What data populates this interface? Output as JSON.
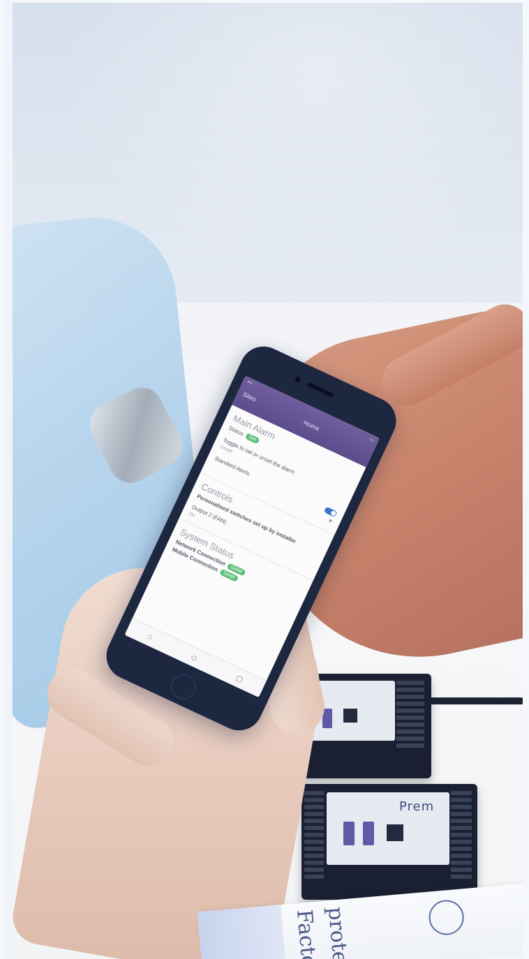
{
  "scene": {
    "description_colors": {
      "phone_header": "#5c4c8c",
      "badge_green": "#5fbf7a",
      "toggle_blue": "#3b76c9",
      "module_body": "#1a2032"
    }
  },
  "phone_app": {
    "nav_back": "Sites",
    "nav_title": "Home",
    "main_alarm": {
      "title": "Main Alarm",
      "status_label": "Status",
      "status_badge": "Set",
      "toggle_text": "Toggle to set or unset the alarm",
      "toggle_sub": "Unset",
      "notifications_label": "Standard Alerts"
    },
    "controls": {
      "title": "Controls",
      "subtitle": "Personalised switches set up by installer",
      "output_label": "Output 2 (FAN)",
      "output_value": "On"
    },
    "system_status": {
      "title": "System Status",
      "network_label": "Network Connection",
      "network_badge": "Good",
      "mobile_label": "Mobile Connection",
      "mobile_badge": "Good"
    }
  },
  "module_labels": {
    "module_1": "",
    "module_2": "Prem"
  },
  "paper_text": {
    "line1": "Factor",
    "line2": "protect"
  }
}
